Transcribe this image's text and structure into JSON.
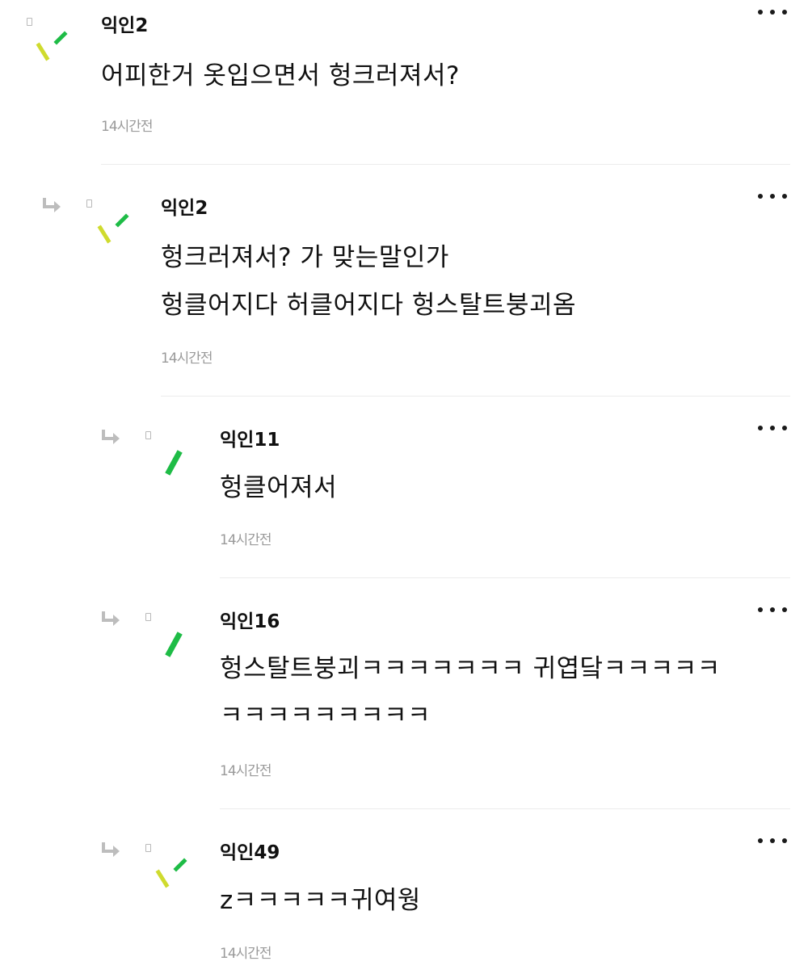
{
  "colors": {
    "text": "#111111",
    "time": "#9a9a9a",
    "divider": "#ececec",
    "avatar_green": "#1ebc46",
    "avatar_yellow": "#cfdb2e",
    "avatar_lime": "#77cc2a"
  },
  "comments": [
    {
      "author": "익인2",
      "lines": [
        "어피한거 옷입으면서 헝크러져서?"
      ],
      "time": "14시간전",
      "avatar_style": "two-strokes",
      "is_reply": false
    },
    {
      "author": "익인2",
      "lines": [
        "헝크러져서? 가 맞는말인가",
        "헝클어지다 허클어지다 헝스탈트붕괴옴"
      ],
      "time": "14시간전",
      "avatar_style": "two-strokes",
      "is_reply": true
    },
    {
      "author": "익인11",
      "lines": [
        "헝클어져서"
      ],
      "time": "14시간전",
      "avatar_style": "one-stroke",
      "is_reply": true
    },
    {
      "author": "익인16",
      "lines": [
        "헝스탈트붕괴ㅋㅋㅋㅋㅋㅋㅋ 귀엽닼ㅋㅋㅋㅋㅋ",
        "ㅋㅋㅋㅋㅋㅋㅋㅋㅋ"
      ],
      "time": "14시간전",
      "avatar_style": "one-stroke",
      "is_reply": true
    },
    {
      "author": "익인49",
      "lines": [
        "zㅋㅋㅋㅋㅋ귀여웡"
      ],
      "time": "14시간전",
      "avatar_style": "two-strokes",
      "is_reply": true
    }
  ]
}
